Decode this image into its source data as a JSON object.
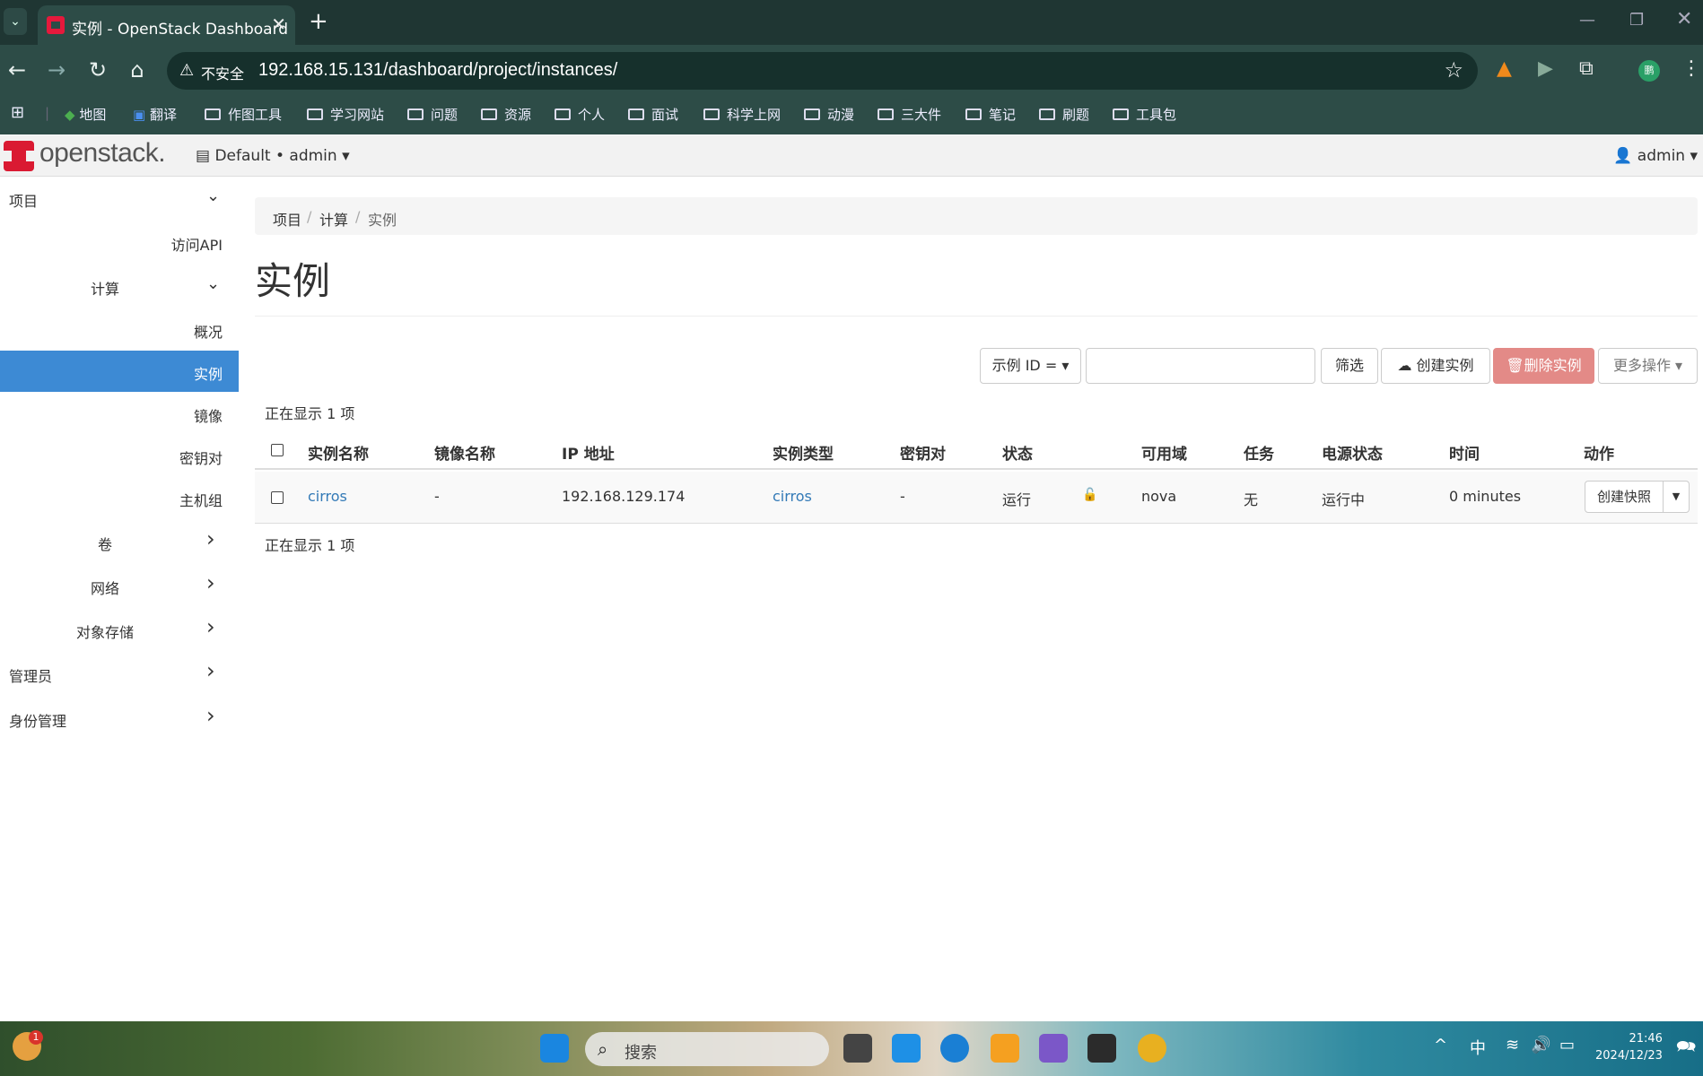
{
  "browser": {
    "tab_title": "实例 - OpenStack Dashboard",
    "insecure_label": "不安全",
    "url": "192.168.15.131/dashboard/project/instances/",
    "profile_initial": "鹏",
    "bookmarks": [
      "地图",
      "翻译",
      "作图工具",
      "学习网站",
      "问题",
      "资源",
      "个人",
      "面试",
      "科学上网",
      "动漫",
      "三大件",
      "笔记",
      "刷题",
      "工具包"
    ]
  },
  "header": {
    "logo": "openstack.",
    "project_selector": "Default • admin ▾",
    "user_menu": "admin ▾"
  },
  "sidebar": {
    "items": [
      {
        "label": "项目",
        "chevron": "⌄"
      },
      {
        "label": "访问API"
      },
      {
        "label": "计算",
        "chevron": "⌄"
      },
      {
        "label": "概况"
      },
      {
        "label": "实例"
      },
      {
        "label": "镜像"
      },
      {
        "label": "密钥对"
      },
      {
        "label": "主机组"
      },
      {
        "label": "卷",
        "chevron": "›"
      },
      {
        "label": "网络",
        "chevron": "›"
      },
      {
        "label": "对象存储",
        "chevron": "›"
      },
      {
        "label": "管理员",
        "chevron": "›"
      },
      {
        "label": "身份管理",
        "chevron": "›"
      }
    ]
  },
  "breadcrumb": [
    "项目",
    "计算",
    "实例"
  ],
  "page_title": "实例",
  "actions": {
    "filter_field": "示例 ID = ▾",
    "filter_button": "筛选",
    "create_button": "创建实例",
    "delete_button": "删除实例",
    "more_button": "更多操作 ▾"
  },
  "count_text": "正在显示 1 项",
  "table": {
    "headers": [
      "实例名称",
      "镜像名称",
      "IP 地址",
      "实例类型",
      "密钥对",
      "状态",
      "可用域",
      "任务",
      "电源状态",
      "时间",
      "动作"
    ],
    "rows": [
      {
        "name": "cirros",
        "image": "-",
        "ip": "192.168.129.174",
        "flavor": "cirros",
        "keypair": "-",
        "status": "运行",
        "zone": "nova",
        "task": "无",
        "power": "运行中",
        "age": "0 minutes",
        "action": "创建快照"
      }
    ]
  },
  "taskbar": {
    "search_placeholder": "搜索",
    "notification_badge": "1",
    "ime": "中",
    "time": "21:46",
    "date": "2024/12/23"
  }
}
